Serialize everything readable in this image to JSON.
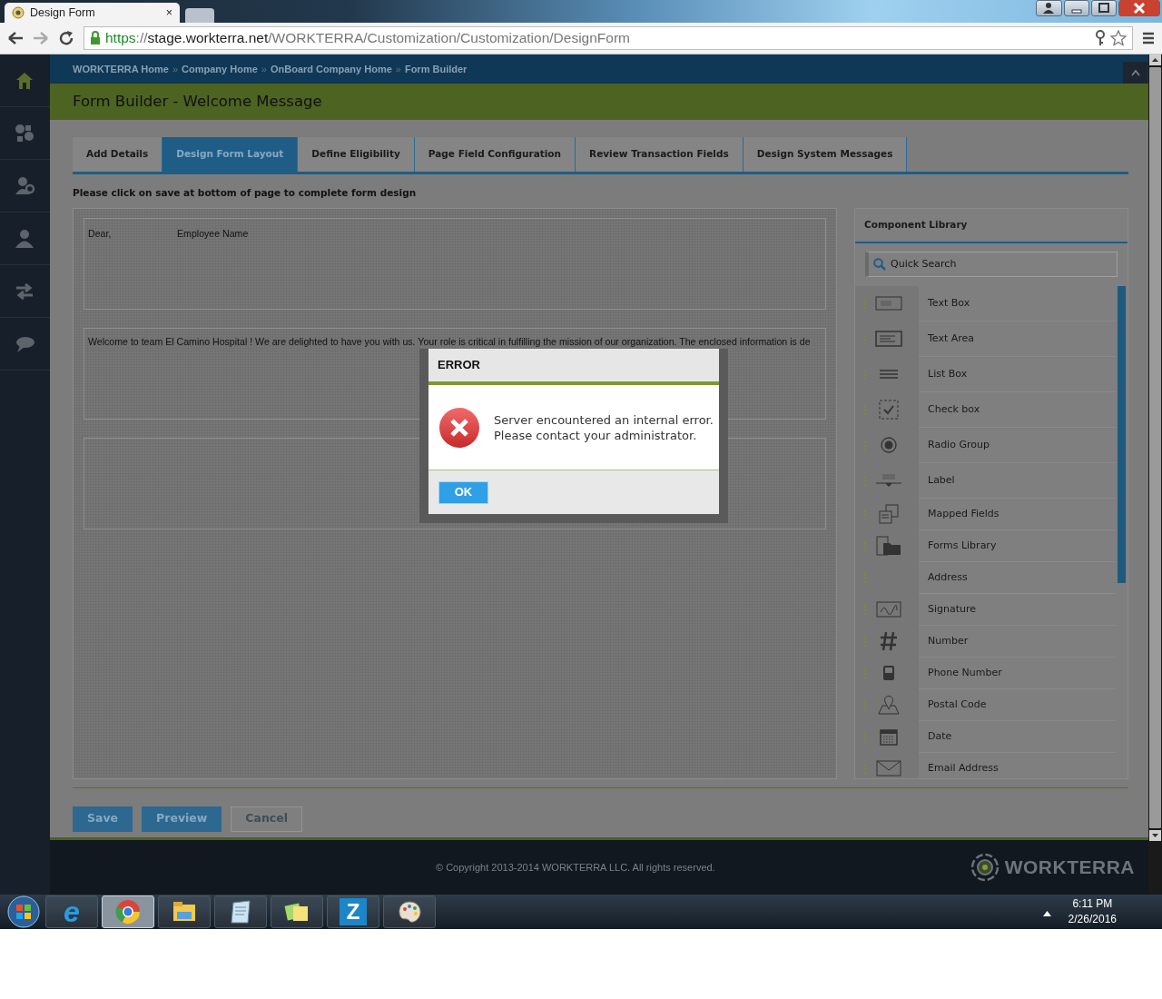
{
  "browser": {
    "tab_title": "Design Form",
    "tab_close": "×",
    "url": {
      "scheme": "https",
      "separator": "://",
      "host": "stage.workterra.net",
      "path": "/WORKTERRA/Customization/Customization/DesignForm"
    }
  },
  "breadcrumbs": {
    "separator": "»",
    "items": [
      "WORKTERRA Home",
      "Company Home",
      "OnBoard Company Home",
      "Form Builder"
    ]
  },
  "page_title": "Form Builder - Welcome Message",
  "tabs": [
    {
      "label": "Add Details",
      "selected": false
    },
    {
      "label": "Design Form Layout",
      "selected": true
    },
    {
      "label": "Define Eligibility",
      "selected": false
    },
    {
      "label": "Page Field Configuration",
      "selected": false
    },
    {
      "label": "Review Transaction Fields",
      "selected": false
    },
    {
      "label": "Design System Messages",
      "selected": false
    }
  ],
  "instruction": "Please click on save at bottom of page to complete form design",
  "form_sections": [
    {
      "kind": "salutation",
      "texts": [
        "Dear,",
        "Employee Name"
      ]
    },
    {
      "kind": "paragraph",
      "text": "Welcome to team El Camino Hospital ! We are delighted to have you with us. Your role is critical in fulfilling the mission of our organization. The enclosed information is de"
    },
    {
      "kind": "blank"
    }
  ],
  "component_library": {
    "title": "Component Library",
    "search_placeholder": "Quick Search",
    "items": [
      {
        "label": "Text Box",
        "kind": "textbox"
      },
      {
        "label": "Text Area",
        "kind": "textarea"
      },
      {
        "label": "List Box",
        "kind": "listbox"
      },
      {
        "label": "Check box",
        "kind": "checkbox"
      },
      {
        "label": "Radio Group",
        "kind": "radio"
      },
      {
        "label": "Label",
        "kind": "label"
      },
      {
        "label": "Mapped Fields",
        "kind": "mapped"
      },
      {
        "label": "Forms Library",
        "kind": "folder"
      },
      {
        "label": "Address",
        "kind": "address"
      },
      {
        "label": "Signature",
        "kind": "signature"
      },
      {
        "label": "Number",
        "kind": "number"
      },
      {
        "label": "Phone Number",
        "kind": "phone"
      },
      {
        "label": "Postal Code",
        "kind": "map"
      },
      {
        "label": "Date",
        "kind": "date"
      },
      {
        "label": "Email Address",
        "kind": "email"
      }
    ]
  },
  "buttons": [
    {
      "label": "Save",
      "kind": "primary"
    },
    {
      "label": "Preview",
      "kind": "primary"
    },
    {
      "label": "Cancel",
      "kind": "secondary"
    }
  ],
  "footer": {
    "copyright": "© Copyright 2013-2014 WORKTERRA LLC. All rights reserved.",
    "logo_text": "WORKTERRA"
  },
  "dialog": {
    "title": "ERROR",
    "message": "Server encountered an internal error.\nPlease contact your administrator.",
    "button": "OK"
  },
  "taskbar": {
    "apps": [
      {
        "kind": "ie",
        "glyph": "e",
        "selected": false
      },
      {
        "kind": "chrome",
        "selected": true
      },
      {
        "kind": "explorer",
        "selected": false
      },
      {
        "kind": "notepad",
        "selected": false
      },
      {
        "kind": "notes",
        "selected": false
      },
      {
        "kind": "z",
        "glyph": "Z",
        "selected": false
      },
      {
        "kind": "paint",
        "selected": false
      }
    ],
    "time": "6:11 PM",
    "date": "2/26/2016"
  }
}
